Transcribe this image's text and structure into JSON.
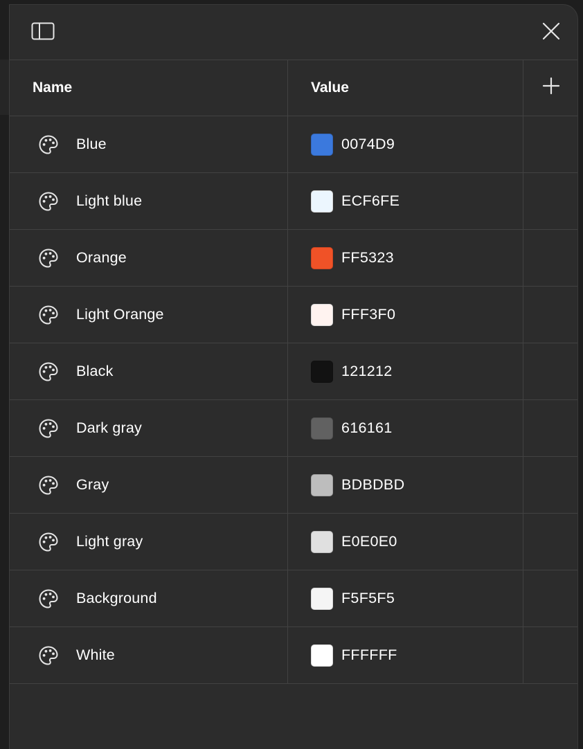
{
  "panel": {
    "sidebar_toggle_icon": "sidebar-panel-icon",
    "close_icon": "close-icon"
  },
  "table": {
    "headers": {
      "name": "Name",
      "value": "Value",
      "add_icon": "plus-icon"
    },
    "rows": [
      {
        "name": "Blue",
        "hex": "0074D9",
        "color": "#3b79dd"
      },
      {
        "name": "Light blue",
        "hex": "ECF6FE",
        "color": "#ecf6fe"
      },
      {
        "name": "Orange",
        "hex": "FF5323",
        "color": "#f05227"
      },
      {
        "name": "Light Orange",
        "hex": "FFF3F0",
        "color": "#fff3f0"
      },
      {
        "name": "Black",
        "hex": "121212",
        "color": "#121212"
      },
      {
        "name": "Dark gray",
        "hex": "616161",
        "color": "#616161"
      },
      {
        "name": "Gray",
        "hex": "BDBDBD",
        "color": "#bdbdbd"
      },
      {
        "name": "Light gray",
        "hex": "E0E0E0",
        "color": "#e0e0e0"
      },
      {
        "name": "Background",
        "hex": "F5F5F5",
        "color": "#f5f5f5"
      },
      {
        "name": "White",
        "hex": "FFFFFF",
        "color": "#ffffff"
      }
    ]
  },
  "colors": {
    "panel_bg": "#2c2c2c",
    "border": "#424242",
    "text": "#ffffff"
  }
}
